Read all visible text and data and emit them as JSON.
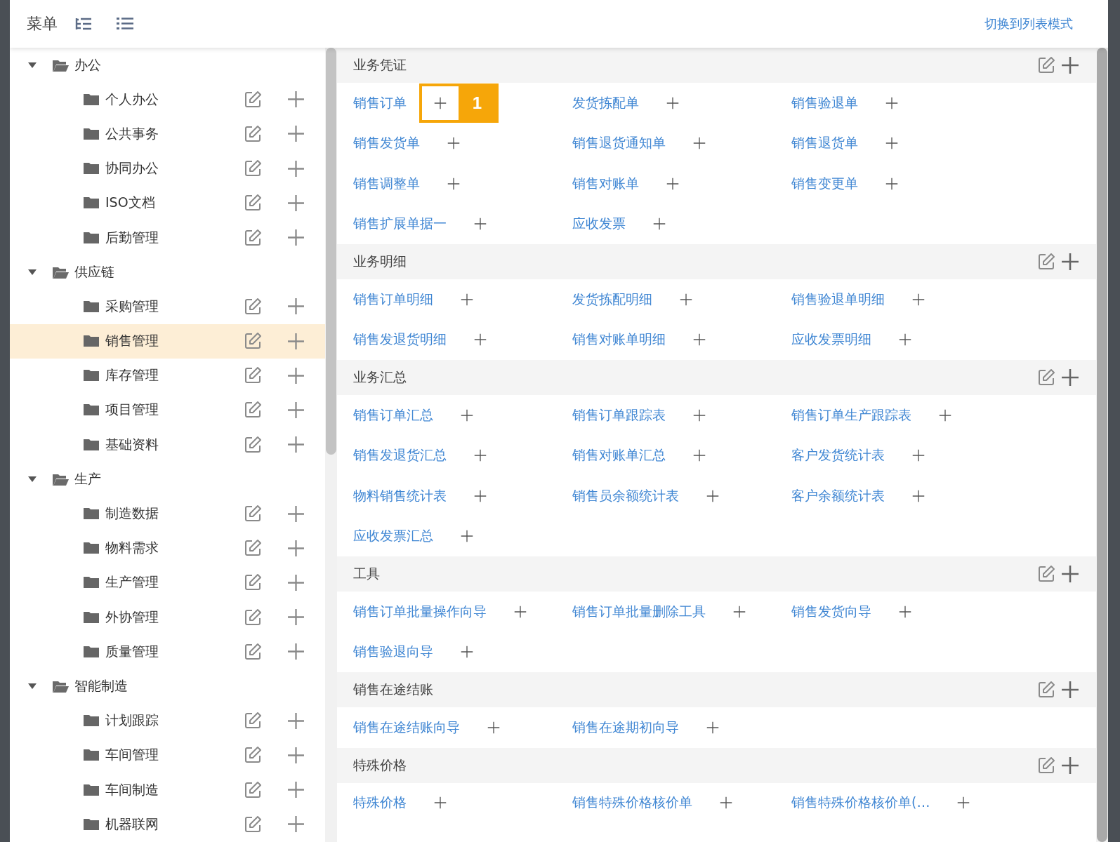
{
  "header": {
    "title": "菜单",
    "link": "切换到列表模式"
  },
  "tree": [
    {
      "label": "办公",
      "expanded": true,
      "children": [
        {
          "label": "个人办公",
          "selected": false
        },
        {
          "label": "公共事务",
          "selected": false
        },
        {
          "label": "协同办公",
          "selected": false
        },
        {
          "label": "ISO文档",
          "selected": false
        },
        {
          "label": "后勤管理",
          "selected": false
        }
      ]
    },
    {
      "label": "供应链",
      "expanded": true,
      "children": [
        {
          "label": "采购管理",
          "selected": false
        },
        {
          "label": "销售管理",
          "selected": true
        },
        {
          "label": "库存管理",
          "selected": false
        },
        {
          "label": "项目管理",
          "selected": false
        },
        {
          "label": "基础资料",
          "selected": false
        }
      ]
    },
    {
      "label": "生产",
      "expanded": true,
      "children": [
        {
          "label": "制造数据",
          "selected": false
        },
        {
          "label": "物料需求",
          "selected": false
        },
        {
          "label": "生产管理",
          "selected": false
        },
        {
          "label": "外协管理",
          "selected": false
        },
        {
          "label": "质量管理",
          "selected": false
        }
      ]
    },
    {
      "label": "智能制造",
      "expanded": true,
      "children": [
        {
          "label": "计划跟踪",
          "selected": false
        },
        {
          "label": "车间管理",
          "selected": false
        },
        {
          "label": "车间制造",
          "selected": false
        },
        {
          "label": "机器联网",
          "selected": false
        }
      ]
    }
  ],
  "sections": [
    {
      "title": "业务凭证",
      "items": [
        {
          "label": "销售订单",
          "callout": "1"
        },
        {
          "label": "发货拣配单"
        },
        {
          "label": "销售验退单"
        },
        {
          "label": "销售发货单"
        },
        {
          "label": "销售退货通知单"
        },
        {
          "label": "销售退货单"
        },
        {
          "label": "销售调整单"
        },
        {
          "label": "销售对账单"
        },
        {
          "label": "销售变更单"
        },
        {
          "label": "销售扩展单据一"
        },
        {
          "label": "应收发票"
        }
      ]
    },
    {
      "title": "业务明细",
      "items": [
        {
          "label": "销售订单明细"
        },
        {
          "label": "发货拣配明细"
        },
        {
          "label": "销售验退单明细"
        },
        {
          "label": "销售发退货明细"
        },
        {
          "label": "销售对账单明细"
        },
        {
          "label": "应收发票明细"
        }
      ]
    },
    {
      "title": "业务汇总",
      "items": [
        {
          "label": "销售订单汇总"
        },
        {
          "label": "销售订单跟踪表"
        },
        {
          "label": "销售订单生产跟踪表"
        },
        {
          "label": "销售发退货汇总"
        },
        {
          "label": "销售对账单汇总"
        },
        {
          "label": "客户发货统计表"
        },
        {
          "label": "物料销售统计表"
        },
        {
          "label": "销售员余额统计表"
        },
        {
          "label": "客户余额统计表"
        },
        {
          "label": "应收发票汇总"
        }
      ]
    },
    {
      "title": "工具",
      "items": [
        {
          "label": "销售订单批量操作向导"
        },
        {
          "label": "销售订单批量删除工具"
        },
        {
          "label": "销售发货向导"
        },
        {
          "label": "销售验退向导"
        }
      ]
    },
    {
      "title": "销售在途结账",
      "items": [
        {
          "label": "销售在途结账向导"
        },
        {
          "label": "销售在途期初向导"
        }
      ]
    },
    {
      "title": "特殊价格",
      "items": [
        {
          "label": "特殊价格"
        },
        {
          "label": "销售特殊价格核价单"
        },
        {
          "label": "销售特殊价格核价单(…"
        }
      ]
    }
  ]
}
